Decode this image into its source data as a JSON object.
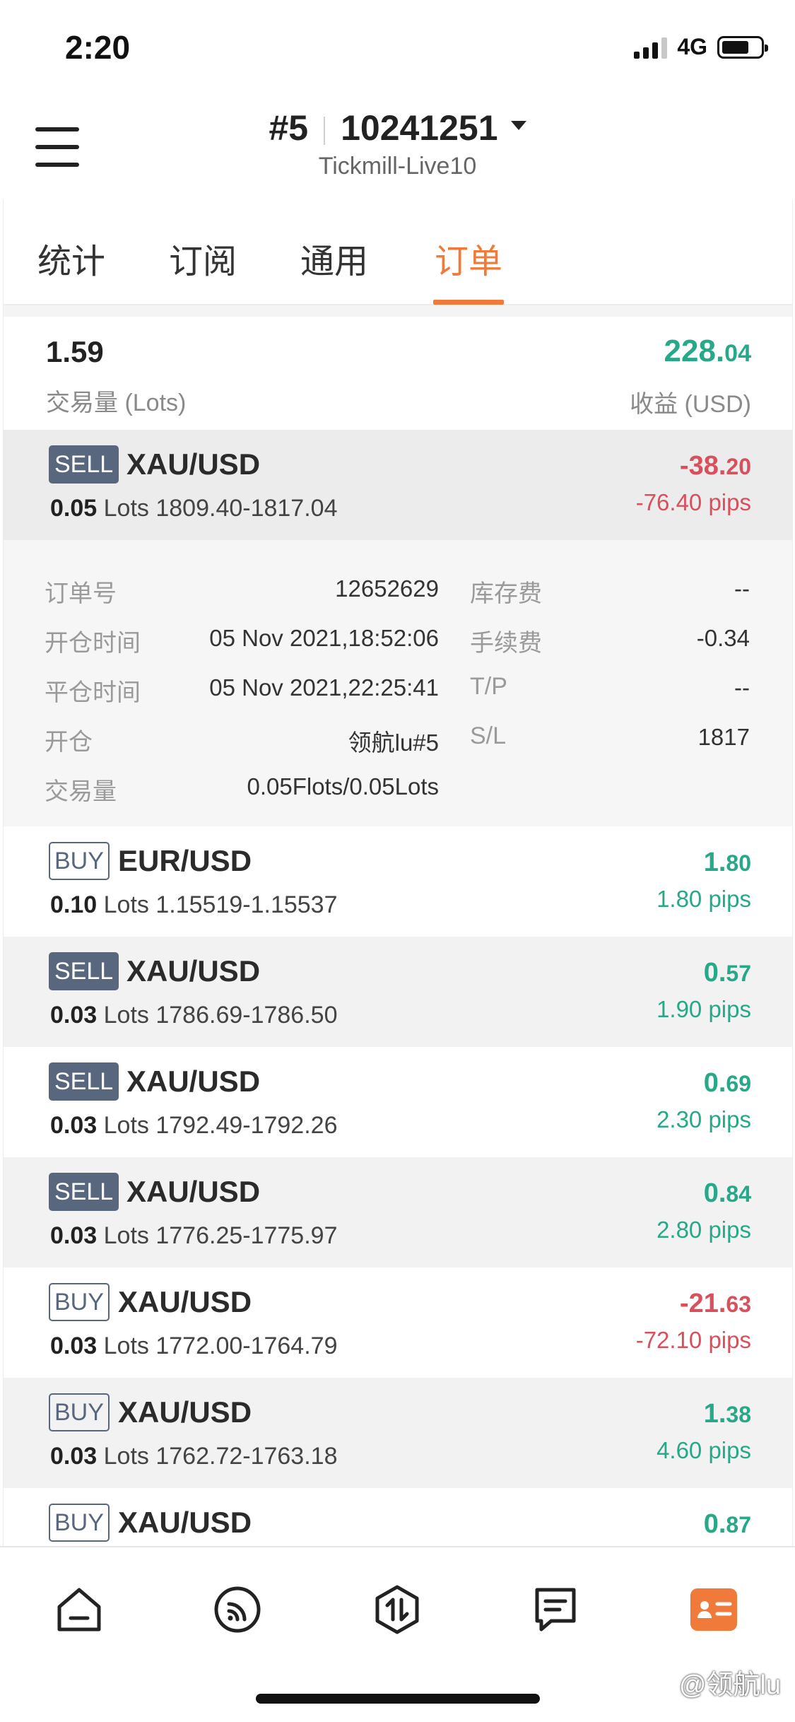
{
  "status_bar": {
    "time": "2:20",
    "network": "4G"
  },
  "header": {
    "account_number": "#5",
    "account_id": "10241251",
    "server": "Tickmill-Live10"
  },
  "tabs": [
    {
      "label": "统计"
    },
    {
      "label": "订阅"
    },
    {
      "label": "通用"
    },
    {
      "label": "订单",
      "active": true
    }
  ],
  "summary": {
    "lots_value": "1.59",
    "lots_label": "交易量 (Lots)",
    "profit_main": "228.",
    "profit_fraction": "04",
    "profit_label": "收益 (USD)"
  },
  "lots_unit": "Lots",
  "orders": [
    {
      "side": "SELL",
      "symbol": "XAU/USD",
      "volume": "0.05",
      "price_range": "1809.40-1817.04",
      "pnl_main": "-38.",
      "pnl_fraction": "20",
      "pips": "-76.40 pips",
      "status": "negative"
    },
    {
      "side": "BUY",
      "symbol": "EUR/USD",
      "volume": "0.10",
      "price_range": "1.15519-1.15537",
      "pnl_main": "1.",
      "pnl_fraction": "80",
      "pips": "1.80 pips",
      "status": "positive"
    },
    {
      "side": "SELL",
      "symbol": "XAU/USD",
      "volume": "0.03",
      "price_range": "1786.69-1786.50",
      "pnl_main": "0.",
      "pnl_fraction": "57",
      "pips": "1.90 pips",
      "status": "positive"
    },
    {
      "side": "SELL",
      "symbol": "XAU/USD",
      "volume": "0.03",
      "price_range": "1792.49-1792.26",
      "pnl_main": "0.",
      "pnl_fraction": "69",
      "pips": "2.30 pips",
      "status": "positive"
    },
    {
      "side": "SELL",
      "symbol": "XAU/USD",
      "volume": "0.03",
      "price_range": "1776.25-1775.97",
      "pnl_main": "0.",
      "pnl_fraction": "84",
      "pips": "2.80 pips",
      "status": "positive"
    },
    {
      "side": "BUY",
      "symbol": "XAU/USD",
      "volume": "0.03",
      "price_range": "1772.00-1764.79",
      "pnl_main": "-21.",
      "pnl_fraction": "63",
      "pips": "-72.10 pips",
      "status": "negative"
    },
    {
      "side": "BUY",
      "symbol": "XAU/USD",
      "volume": "0.03",
      "price_range": "1762.72-1763.18",
      "pnl_main": "1.",
      "pnl_fraction": "38",
      "pips": "4.60 pips",
      "status": "positive"
    },
    {
      "side": "BUY",
      "symbol": "XAU/USD",
      "pnl_main": "0.",
      "pnl_fraction": "87",
      "status": "positive"
    }
  ],
  "order_detail": {
    "order_no_label": "订单号",
    "order_no": "12652629",
    "swap_label": "库存费",
    "swap": "--",
    "open_time_label": "开仓时间",
    "open_time": "05 Nov 2021,18:52:06",
    "commission_label": "手续费",
    "commission": "-0.34",
    "close_time_label": "平仓时间",
    "close_time": "05 Nov 2021,22:25:41",
    "tp_label": "T/P",
    "tp": "--",
    "open_label": "开仓",
    "open_by": "领航lu#5",
    "sl_label": "S/L",
    "sl": "1817",
    "volume_label": "交易量",
    "volume": "0.05Flots/0.05Lots"
  },
  "bottom_nav": [
    {
      "icon": "home-icon"
    },
    {
      "icon": "signal-feed-icon"
    },
    {
      "icon": "trade-icon"
    },
    {
      "icon": "message-icon"
    },
    {
      "icon": "profile-card-icon",
      "active": true
    }
  ],
  "watermark": "@领航lu",
  "colors": {
    "accent": "#f07a3a",
    "positive": "#27a889",
    "negative": "#d9505d",
    "badge": "#58677d"
  }
}
